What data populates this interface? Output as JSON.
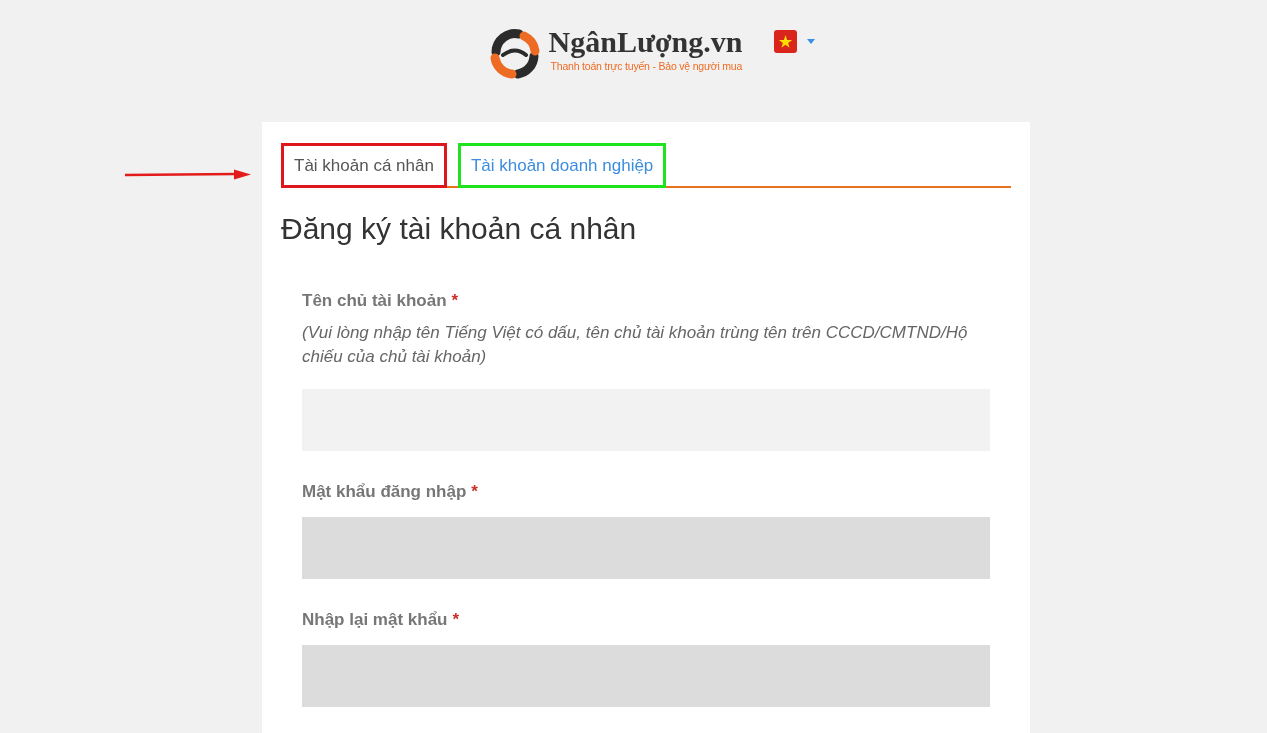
{
  "header": {
    "logo": {
      "name": "NgânLượng.vn",
      "tagline": "Thanh toán trực tuyến - Bảo vệ người mua"
    }
  },
  "tabs": [
    {
      "label": "Tài khoản cá nhân",
      "selected": true,
      "color": "#e0161e"
    },
    {
      "label": "Tài khoản doanh nghiệp",
      "selected": false,
      "color": "#1ee41e"
    }
  ],
  "form": {
    "title": "Đăng ký tài khoản cá nhân",
    "fields": [
      {
        "kind": "text",
        "label": "Tên chủ tài khoản",
        "required_mark": "*",
        "hint": "(Vui lòng nhập tên Tiếng Việt có dấu, tên chủ tài khoản trùng tên trên CCCD/CMTND/Hộ chiếu của chủ tài khoản)"
      },
      {
        "kind": "password",
        "label": "Mật khẩu đăng nhập",
        "required_mark": "*"
      },
      {
        "kind": "password",
        "label": "Nhập lại mật khẩu",
        "required_mark": "*"
      }
    ]
  }
}
